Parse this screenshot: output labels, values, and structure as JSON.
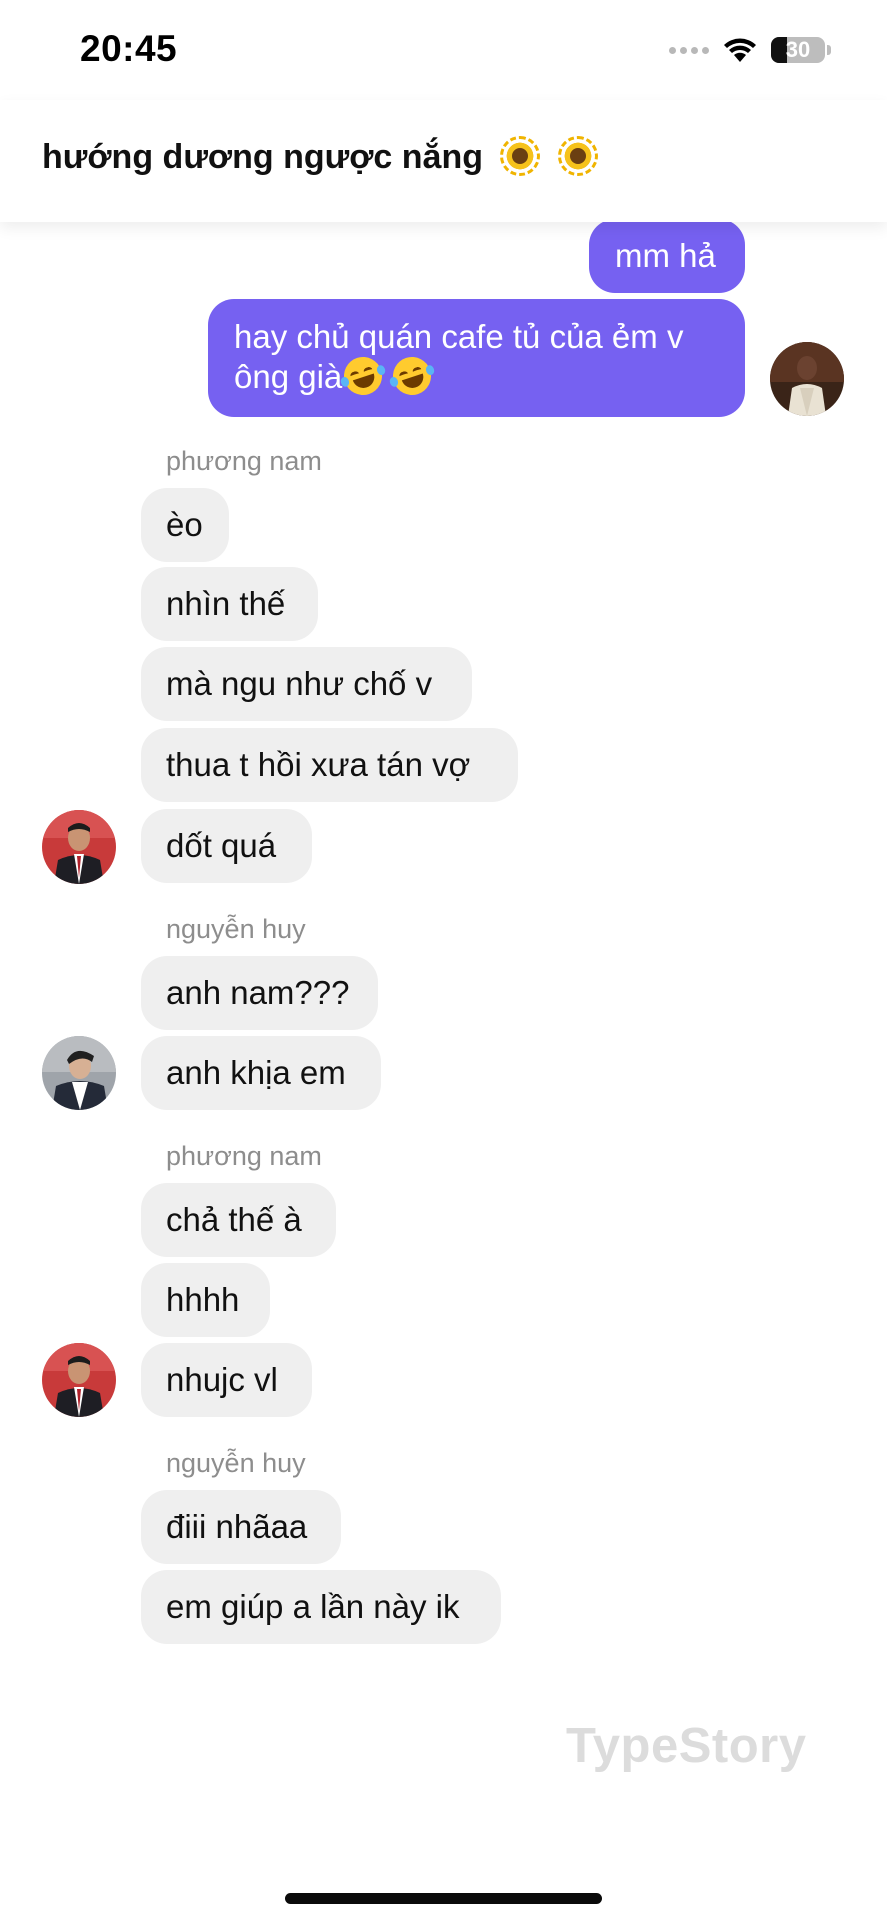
{
  "status_bar": {
    "time": "20:45",
    "battery_level": "30",
    "battery_fraction": 0.3
  },
  "header": {
    "title": "hướng dương ngược nắng",
    "icons": [
      "sunflower-icon",
      "sunflower-icon"
    ]
  },
  "messages": {
    "outgoing": [
      {
        "text": "mm hả"
      },
      {
        "line1": "hay chủ quán cafe tủ của ẻm v",
        "line2": "ông già",
        "emojis": [
          "rolling-on-floor-laughing-icon",
          "rolling-on-floor-laughing-icon"
        ]
      }
    ],
    "groups": [
      {
        "sender": "phương nam",
        "messages": [
          "èo",
          "nhìn thế",
          "mà ngu như chố v",
          "thua t hồi xưa tán vợ",
          "dốt quá"
        ]
      },
      {
        "sender": "nguyễn huy",
        "messages": [
          "anh nam???",
          "anh khịa em"
        ]
      },
      {
        "sender": "phương nam",
        "messages": [
          "chả thế à",
          "hhhh",
          "nhujc vl"
        ]
      },
      {
        "sender": "nguyễn huy",
        "messages": [
          "điii nhãaa",
          "em giúp a lần này ik"
        ]
      }
    ]
  },
  "watermark": "TypeStory",
  "colors": {
    "outgoing_bubble": "#7661f1",
    "incoming_bubble": "#efefef",
    "sender_name": "#8d8d8d",
    "watermark": "#dcdcdc"
  }
}
